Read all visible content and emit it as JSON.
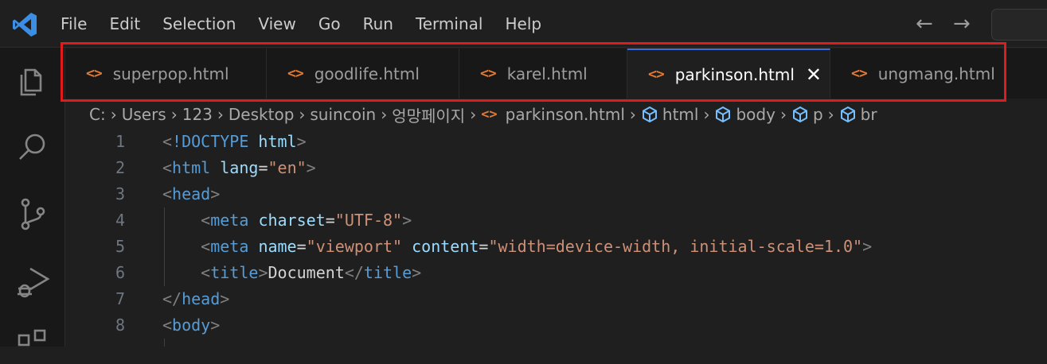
{
  "menu": [
    "File",
    "Edit",
    "Selection",
    "View",
    "Go",
    "Run",
    "Terminal",
    "Help"
  ],
  "nav": {
    "back": "←",
    "forward": "→"
  },
  "tabs": [
    {
      "label": "superpop.html",
      "active": false
    },
    {
      "label": "goodlife.html",
      "active": false
    },
    {
      "label": "karel.html",
      "active": false
    },
    {
      "label": "parkinson.html",
      "active": true
    },
    {
      "label": "ungmang.html",
      "active": false
    }
  ],
  "tab_icon": "<>",
  "tab_close": "✕",
  "breadcrumb": {
    "folders": [
      "C:",
      "Users",
      "123",
      "Desktop",
      "suincoin",
      "엉망페이지"
    ],
    "file": "parkinson.html",
    "symbols": [
      "html",
      "body",
      "p",
      "br"
    ],
    "separator": "›"
  },
  "editor": {
    "lines": [
      {
        "n": "1",
        "indent": 0,
        "tokens": [
          [
            "punc",
            "<"
          ],
          [
            "tag",
            "!DOCTYPE"
          ],
          [
            "text",
            " "
          ],
          [
            "attr",
            "html"
          ],
          [
            "punc",
            ">"
          ]
        ]
      },
      {
        "n": "2",
        "indent": 0,
        "tokens": [
          [
            "punc",
            "<"
          ],
          [
            "tag",
            "html"
          ],
          [
            "text",
            " "
          ],
          [
            "attr",
            "lang"
          ],
          [
            "text",
            "="
          ],
          [
            "str",
            "\"en\""
          ],
          [
            "punc",
            ">"
          ]
        ]
      },
      {
        "n": "3",
        "indent": 0,
        "tokens": [
          [
            "punc",
            "<"
          ],
          [
            "tag",
            "head"
          ],
          [
            "punc",
            ">"
          ]
        ]
      },
      {
        "n": "4",
        "indent": 1,
        "tokens": [
          [
            "punc",
            "<"
          ],
          [
            "tag",
            "meta"
          ],
          [
            "text",
            " "
          ],
          [
            "attr",
            "charset"
          ],
          [
            "text",
            "="
          ],
          [
            "str",
            "\"UTF-8\""
          ],
          [
            "punc",
            ">"
          ]
        ]
      },
      {
        "n": "5",
        "indent": 1,
        "tokens": [
          [
            "punc",
            "<"
          ],
          [
            "tag",
            "meta"
          ],
          [
            "text",
            " "
          ],
          [
            "attr",
            "name"
          ],
          [
            "text",
            "="
          ],
          [
            "str",
            "\"viewport\""
          ],
          [
            "text",
            " "
          ],
          [
            "attr",
            "content"
          ],
          [
            "text",
            "="
          ],
          [
            "str",
            "\"width=device-width, initial-scale=1.0\""
          ],
          [
            "punc",
            ">"
          ]
        ]
      },
      {
        "n": "6",
        "indent": 1,
        "tokens": [
          [
            "punc",
            "<"
          ],
          [
            "tag",
            "title"
          ],
          [
            "punc",
            ">"
          ],
          [
            "text",
            "Document"
          ],
          [
            "punc",
            "</"
          ],
          [
            "tag",
            "title"
          ],
          [
            "punc",
            ">"
          ]
        ]
      },
      {
        "n": "7",
        "indent": 0,
        "tokens": [
          [
            "punc",
            "</"
          ],
          [
            "tag",
            "head"
          ],
          [
            "punc",
            ">"
          ]
        ]
      },
      {
        "n": "8",
        "indent": 0,
        "tokens": [
          [
            "punc",
            "<"
          ],
          [
            "tag",
            "body"
          ],
          [
            "punc",
            ">"
          ]
        ]
      }
    ]
  },
  "colors": {
    "accent": "#3f6fdc",
    "highlight": "#e01b1b",
    "html_icon": "#e37933"
  }
}
